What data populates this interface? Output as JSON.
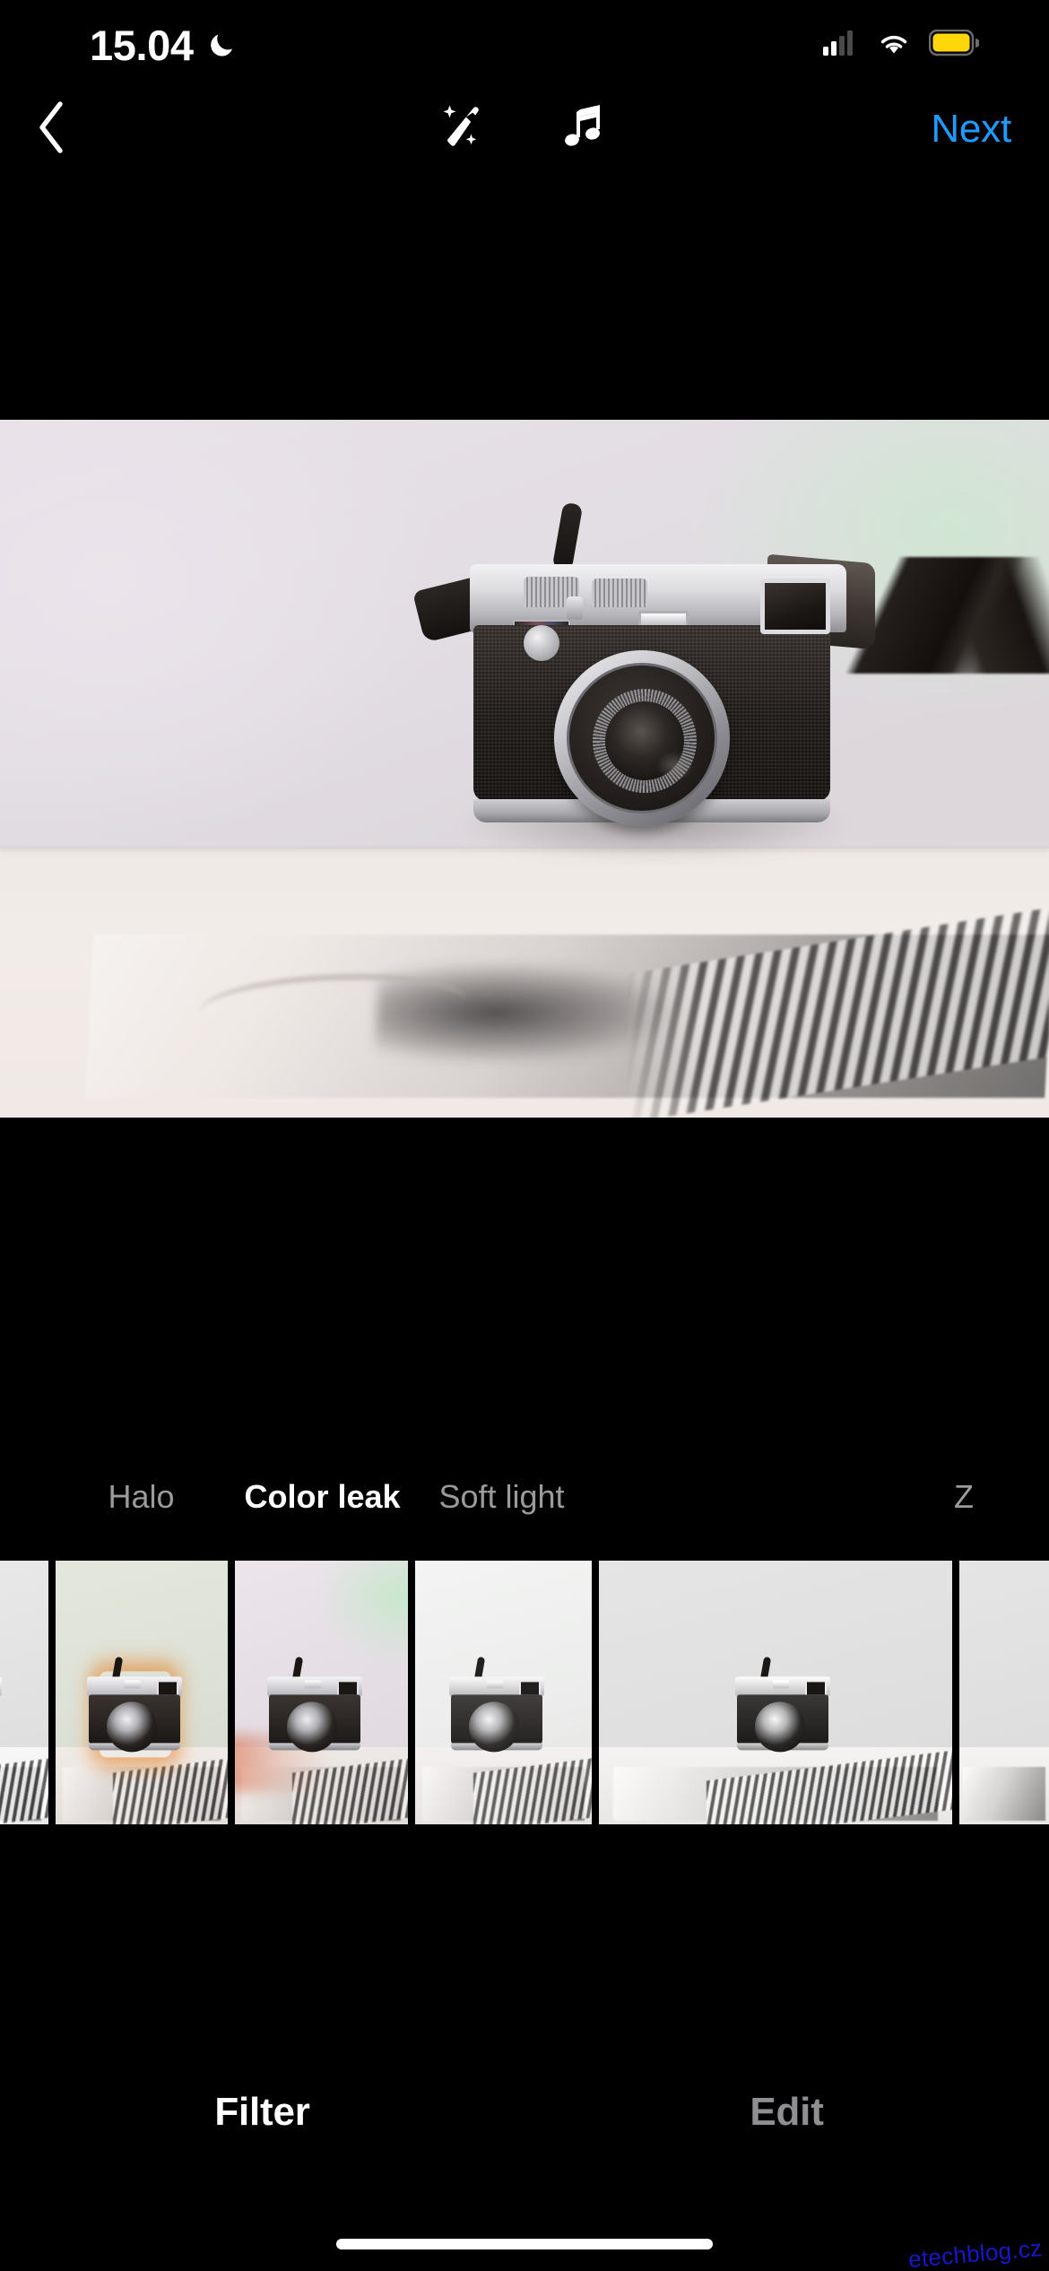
{
  "status_bar": {
    "time": "15.04",
    "icons": {
      "dnd": "crescent-moon-icon",
      "cellular": "cellular-signal-icon",
      "wifi": "wifi-icon",
      "battery": "battery-icon"
    },
    "battery_color": "#FFD60A",
    "signal_bars_active": 2,
    "signal_bars_total": 4
  },
  "nav_bar": {
    "back_icon": "chevron-left-icon",
    "enhance_icon": "magic-wand-icon",
    "music_icon": "music-note-icon",
    "next_label": "Next",
    "next_color": "#1E9BFF"
  },
  "editor": {
    "photo_subject": "vintage rangefinder camera on desk with black and white print",
    "canvas_background": "#000000"
  },
  "filters": {
    "selected": "Color leak",
    "items": [
      {
        "name": "",
        "style": "f-bw",
        "label_visible": false,
        "selected": false
      },
      {
        "name": "Halo",
        "style": "f-halo",
        "label_visible": true,
        "selected": false
      },
      {
        "name": "Color leak",
        "style": "f-colorleak",
        "label_visible": true,
        "selected": true
      },
      {
        "name": "Soft light",
        "style": "f-soft",
        "label_visible": true,
        "selected": false
      },
      {
        "name": "Z",
        "style": "f-z",
        "label_visible": true,
        "selected": false
      }
    ],
    "label_color_inactive": "#9B9B9B",
    "label_color_active": "#FFFFFF"
  },
  "mode_tabs": {
    "items": [
      {
        "label": "Filter",
        "active": true
      },
      {
        "label": "Edit",
        "active": false
      }
    ],
    "active_color": "#FFFFFF",
    "inactive_color": "#8E8E93"
  },
  "watermark": {
    "text": "etechblog.cz",
    "color": "#1a1ad6"
  }
}
